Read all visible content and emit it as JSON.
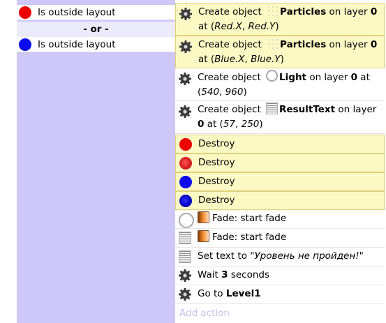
{
  "conditions": {
    "rows": [
      {
        "object_color": "#ee0000",
        "label": "Is outside layout"
      },
      {
        "object_color": "#0b0bee",
        "label": "Is outside layout"
      }
    ],
    "separator": "- or -"
  },
  "actions": {
    "create_red_particles": {
      "prefix": "Create object",
      "object": "Particles",
      "mid": "on layer",
      "layer": "0",
      "at": "at (",
      "x": "Red.X",
      "sep": ", ",
      "y": "Red.Y",
      "end": ")"
    },
    "create_blue_particles": {
      "prefix": "Create object",
      "object": "Particles",
      "mid": "on layer",
      "layer": "0",
      "at": "at (",
      "x": "Blue.X",
      "sep": ", ",
      "y": "Blue.Y",
      "end": ")"
    },
    "create_light": {
      "prefix": "Create object",
      "object": "Light",
      "mid": "on layer",
      "layer": "0",
      "at": "at (",
      "x": "540",
      "sep": ", ",
      "y": "960",
      "end": ")"
    },
    "create_resulttext": {
      "prefix": "Create object",
      "object": "ResultText",
      "mid": "on layer",
      "layer": "0",
      "at": "at (",
      "x": "57",
      "sep": ", ",
      "y": "250",
      "end": ")"
    },
    "destroy_1": "Destroy",
    "destroy_2": "Destroy",
    "destroy_3": "Destroy",
    "destroy_4": "Destroy",
    "fade_1": "Fade: start fade",
    "fade_2": "Fade: start fade",
    "set_text": {
      "prefix": "Set text to ",
      "value": "\"Уровень не пройден!\""
    },
    "wait": {
      "prefix": "Wait",
      "value": "3",
      "suffix": "seconds"
    },
    "goto": {
      "prefix": "Go to",
      "target": "Level1"
    },
    "add_action": "Add action"
  },
  "icons": {
    "system": "gear-icon",
    "particles": "particles-icon",
    "light": "ring-icon",
    "text": "text-object-icon",
    "fade": "fade-behavior-icon"
  },
  "colors": {
    "condition_bg": "#cec8f8",
    "highlight_bg": "#fdf9c5",
    "highlight_border": "#ddd27a",
    "add_action_text": "#c7c3ea"
  }
}
